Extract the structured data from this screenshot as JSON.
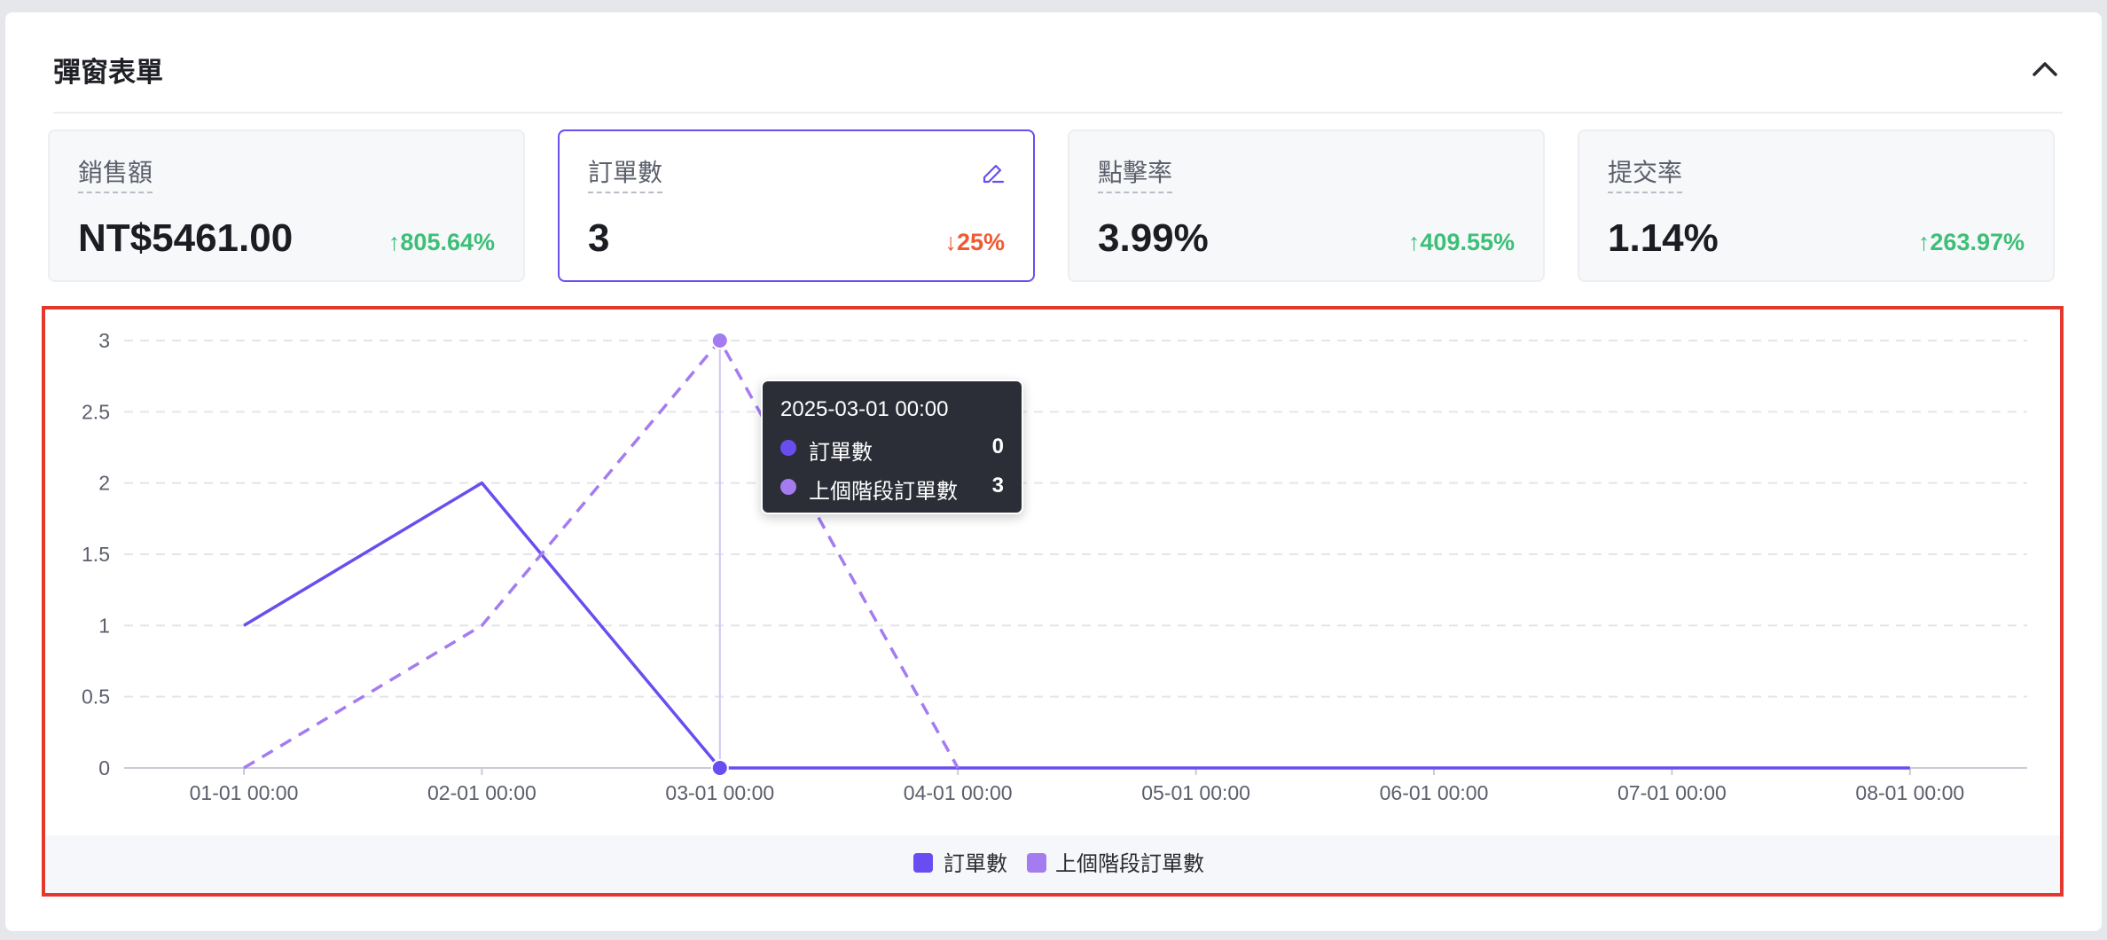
{
  "panel": {
    "title": "彈窗表單"
  },
  "cards": [
    {
      "label": "銷售額",
      "value": "NT$5461.00",
      "change": "805.64%",
      "direction": "up"
    },
    {
      "label": "訂單數",
      "value": "3",
      "change": "25%",
      "direction": "down"
    },
    {
      "label": "點擊率",
      "value": "3.99%",
      "change": "409.55%",
      "direction": "up"
    },
    {
      "label": "提交率",
      "value": "1.14%",
      "change": "263.97%",
      "direction": "up"
    }
  ],
  "tooltip": {
    "title": "2025-03-01 00:00",
    "rows": [
      {
        "name": "訂單數",
        "value": "0"
      },
      {
        "name": "上個階段訂單數",
        "value": "3"
      }
    ]
  },
  "colors": {
    "current": "#6a4df0",
    "previous": "#a47cf0",
    "up": "#3cbf77",
    "down": "#ef5a32",
    "highlight_border": "#e4382c"
  },
  "chart_data": {
    "type": "line",
    "categories": [
      "01-01 00:00",
      "02-01 00:00",
      "03-01 00:00",
      "04-01 00:00",
      "05-01 00:00",
      "06-01 00:00",
      "07-01 00:00",
      "08-01 00:00"
    ],
    "series": [
      {
        "name": "訂單數",
        "values": [
          1,
          2,
          0,
          0,
          0,
          0,
          0,
          0
        ],
        "style": "solid"
      },
      {
        "name": "上個階段訂單數",
        "values": [
          0,
          1,
          3,
          0,
          null,
          null,
          null,
          null
        ],
        "style": "dashed"
      }
    ],
    "yticks": [
      "0",
      "0.5",
      "1",
      "1.5",
      "2",
      "2.5",
      "3"
    ],
    "ylim": [
      0,
      3
    ],
    "grid": true,
    "legend": "bottom",
    "highlight_index": 2
  }
}
